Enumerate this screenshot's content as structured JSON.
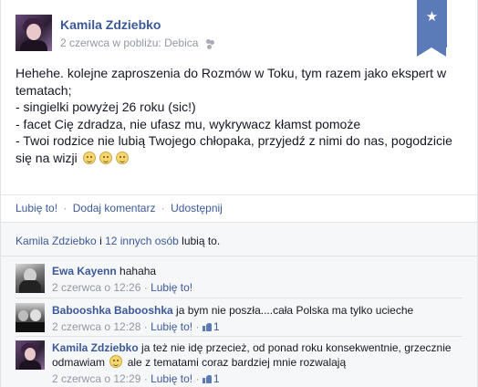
{
  "post": {
    "author": "Kamila Zdziebko",
    "date": "2 czerwca",
    "location_prefix": "w pobliżu:",
    "location": "Debica",
    "privacy_icon": "friends-icon",
    "highlight_icon": "star-icon",
    "text_lines": [
      "Hehehe. kolejne zaproszenia do Rozmów w Toku, tym razem jako ekspert w tematach;",
      "- singielki powyżej 26 roku (sic!)",
      "- facet Cię zdradza, nie ufasz mu, wykrywacz kłamst pomoże",
      "- Twoi rodzice nie lubią Twojego chłopaka, przyjedź z nimi do nas, pogodzicie się na wizji"
    ]
  },
  "actions": {
    "like": "Lubię to!",
    "comment": "Dodaj komentarz",
    "share": "Udostępnij",
    "separator": "·"
  },
  "likes": {
    "names": "Kamila Zdziebko",
    "connector": "i",
    "others": "12 innych osób",
    "suffix": "lubią to."
  },
  "comments": [
    {
      "name": "Ewa Kayenn",
      "text": "hahaha",
      "date": "2 czerwca o 12:26",
      "like": "Lubię to!",
      "like_count": ""
    },
    {
      "name": "Babooshka Babooshka",
      "text": "ja bym nie poszła....cała Polska ma tylko ucieche",
      "date": "2 czerwca o 12:28",
      "like": "Lubię to!",
      "like_count": "1"
    },
    {
      "name": "Kamila Zdziebko",
      "text_a": "ja też nie idę przecież, od ponad roku konsekwentnie, grzecznie odmawiam",
      "text_b": "ale z tematami coraz bardziej mnie rozwalają",
      "date": "2 czerwca o 12:29",
      "like": "Lubię to!",
      "like_count": "1"
    }
  ],
  "colors": {
    "link": "#3b5998",
    "muted": "#9197a3",
    "ribbon": "#5b7ab8",
    "ufi_background": "#f6f7f8"
  }
}
